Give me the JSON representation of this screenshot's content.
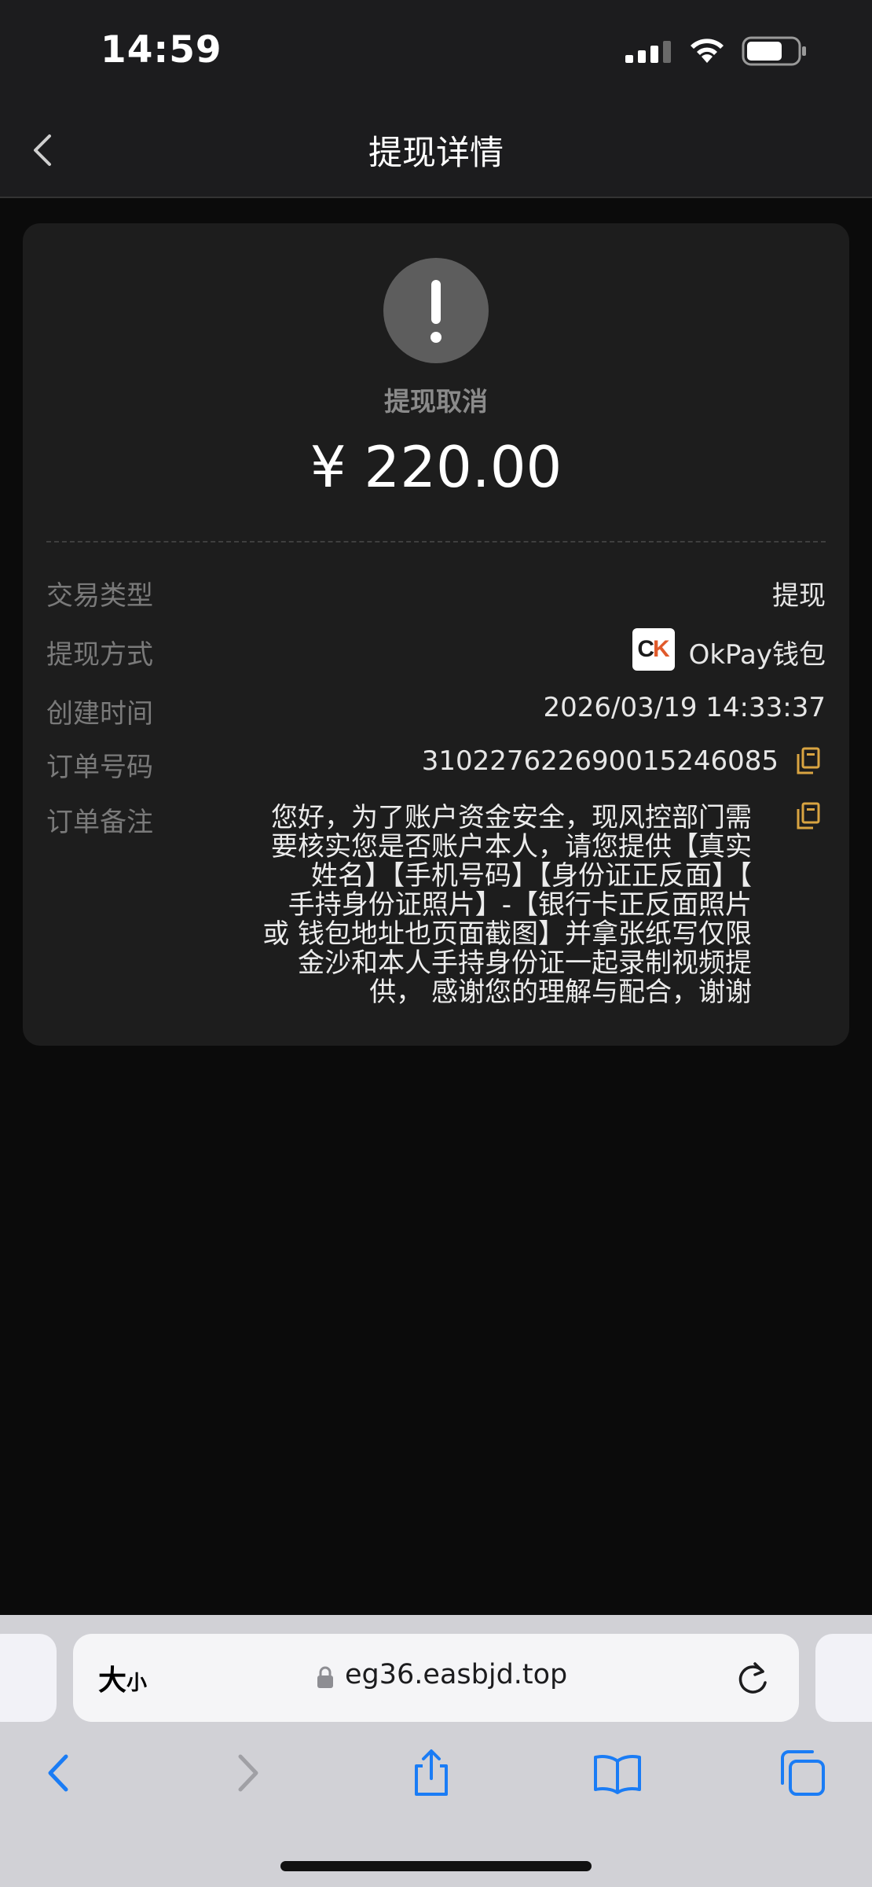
{
  "status_bar": {
    "time": "14:59"
  },
  "nav": {
    "title": "提现详情"
  },
  "card": {
    "status_text": "提现取消",
    "amount": "¥ 220.00",
    "rows": [
      {
        "label": "交易类型",
        "value": "提现"
      },
      {
        "label": "提现方式",
        "value": "OkPay钱包"
      },
      {
        "label": "创建时间",
        "value": "2026/03/19 14:33:37"
      },
      {
        "label": "订单号码",
        "value": "310227622690015246085"
      },
      {
        "label": "订单备注",
        "value": "您好，为了账户资金安全，现风控部门需要核实您是否账户本人，请您提供【真实姓名】【手机号码】【身份证正反面】【手持身份证照片】-【银行卡正反面照片 或 钱包地址也页面截图】并拿张纸写仅限金沙和本人手持身份证一起录制视频提供，感谢您的理解与配合，谢谢"
      }
    ],
    "remark_lines": [
      "您好，为了账户资金安全，现风控部门需",
      "要核实您是否账户本人，请您提供【真实",
      "姓名】【手机号码】【身份证正反面】【",
      "手持身份证照片】-【银行卡正反面照片",
      "或 钱包地址也页面截图】并拿张纸写仅限",
      "金沙和本人手持身份证一起录制视频提",
      "供， 感谢您的理解与配合，谢谢"
    ],
    "icons": {
      "status": "exclamation-icon",
      "copy": "copy-icon",
      "wallet_logo": "okpay-logo"
    },
    "colors": {
      "copy_icon": "#d9a441",
      "status_circle": "#5d5d5d"
    }
  },
  "browser": {
    "aa_big": "大",
    "aa_small": "小",
    "url": "eg36.easbjd.top",
    "accent_color": "#1a7cf5"
  }
}
